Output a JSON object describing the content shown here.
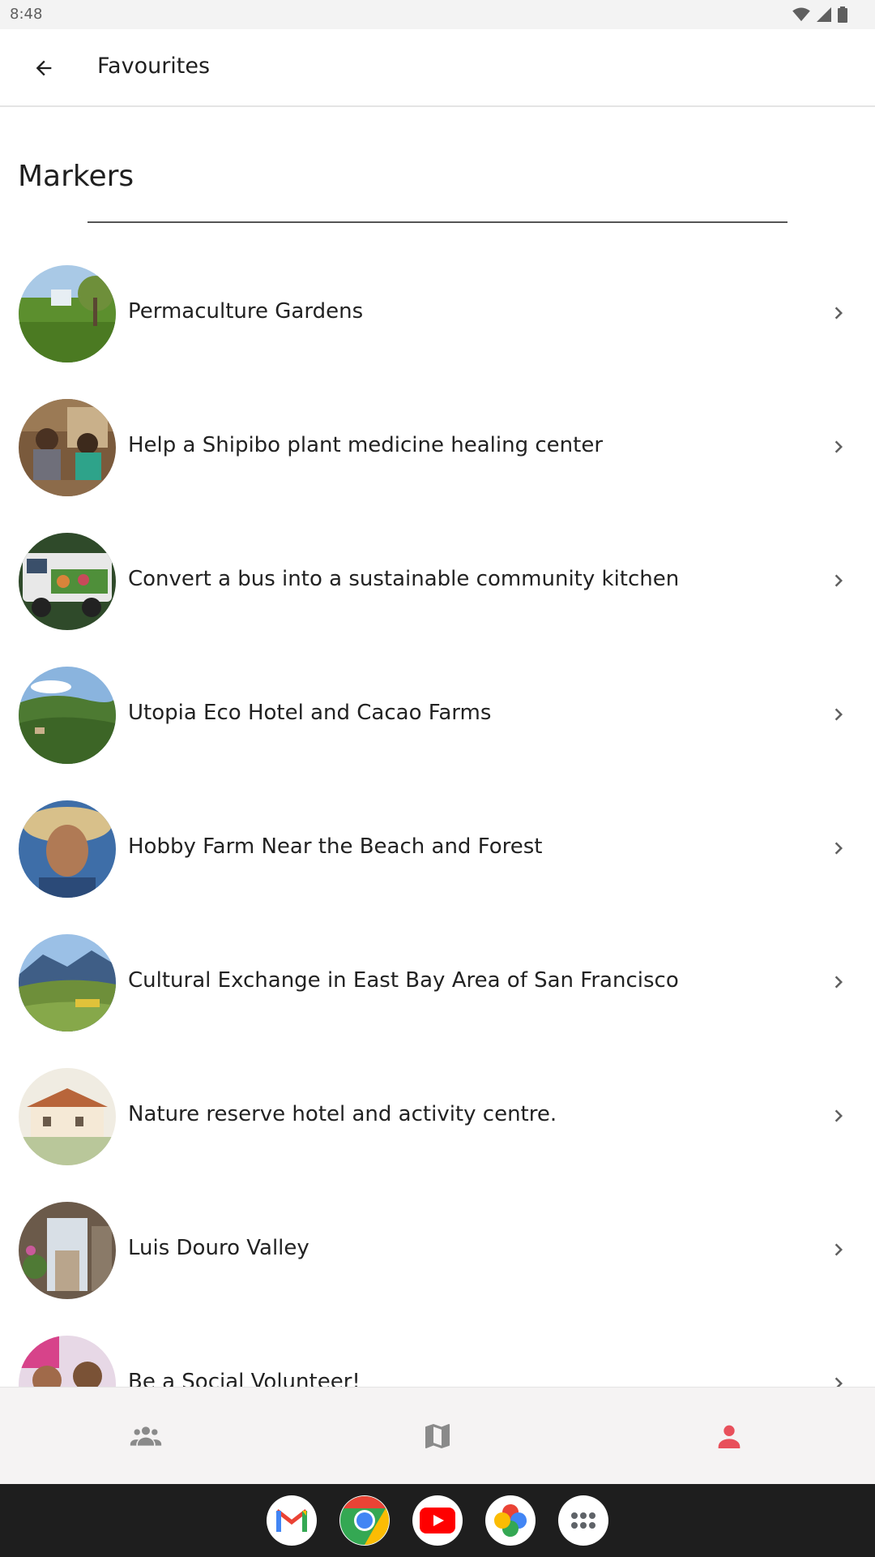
{
  "status_bar": {
    "time": "8:48"
  },
  "app_bar": {
    "title": "Favourites",
    "back_icon": "arrow-back-icon"
  },
  "section": {
    "title": "Markers"
  },
  "markers": [
    {
      "label": "Permaculture Gardens",
      "thumb": "garden-photo"
    },
    {
      "label": "Help a Shipibo plant medicine healing center",
      "thumb": "people-photo"
    },
    {
      "label": "Convert a bus into a sustainable community kitchen",
      "thumb": "bus-photo"
    },
    {
      "label": "Utopia Eco Hotel and Cacao Farms",
      "thumb": "forest-photo"
    },
    {
      "label": "Hobby Farm Near the Beach and Forest",
      "thumb": "portrait-photo"
    },
    {
      "label": "Cultural Exchange in East Bay Area of San Francisco",
      "thumb": "hills-photo"
    },
    {
      "label": "Nature reserve hotel and activity centre.",
      "thumb": "hotel-painting"
    },
    {
      "label": "Luis Douro Valley",
      "thumb": "alley-photo"
    },
    {
      "label": "Be a Social Volunteer!",
      "thumb": "volunteer-photo"
    }
  ],
  "bottom_nav": {
    "items": [
      "group-icon",
      "map-icon",
      "person-icon"
    ],
    "active_color": "#e8505b",
    "inactive_color": "#8a8a8a"
  },
  "dock": {
    "apps": [
      "gmail-icon",
      "chrome-icon",
      "youtube-icon",
      "photos-icon",
      "app-drawer-icon"
    ]
  }
}
